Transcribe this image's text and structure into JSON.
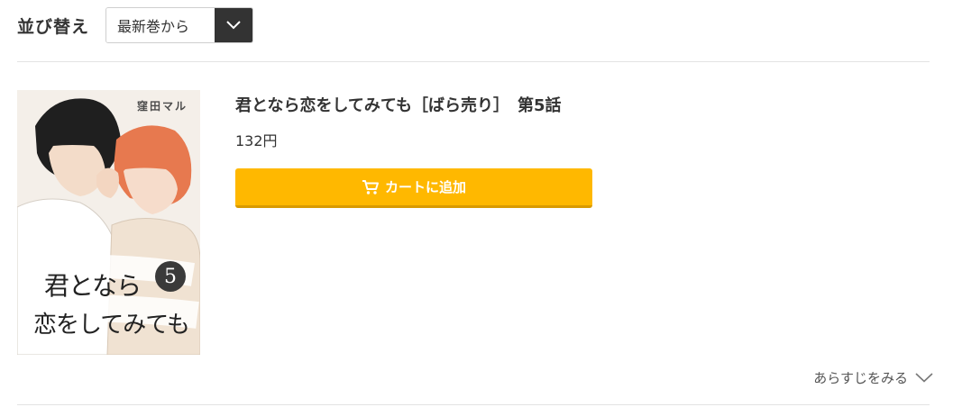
{
  "sort": {
    "label": "並び替え",
    "selected": "最新巻から",
    "toggle_icon": "chevron-down-icon"
  },
  "product": {
    "title": "君となら恋をしてみても［ばら売り］　第5話",
    "price": "132円",
    "cart_button_label": "カートに追加",
    "cart_icon": "cart-plus-icon",
    "cover": {
      "author": "窪田マル",
      "title_line1": "君となら",
      "title_line2": "恋をしてみても",
      "volume": "5"
    }
  },
  "synopsis": {
    "label": "あらすじをみる",
    "icon": "chevron-down-icon"
  },
  "colors": {
    "accent": "#ffb800",
    "dark_toggle": "#333333",
    "divider": "#e3e3e3"
  }
}
